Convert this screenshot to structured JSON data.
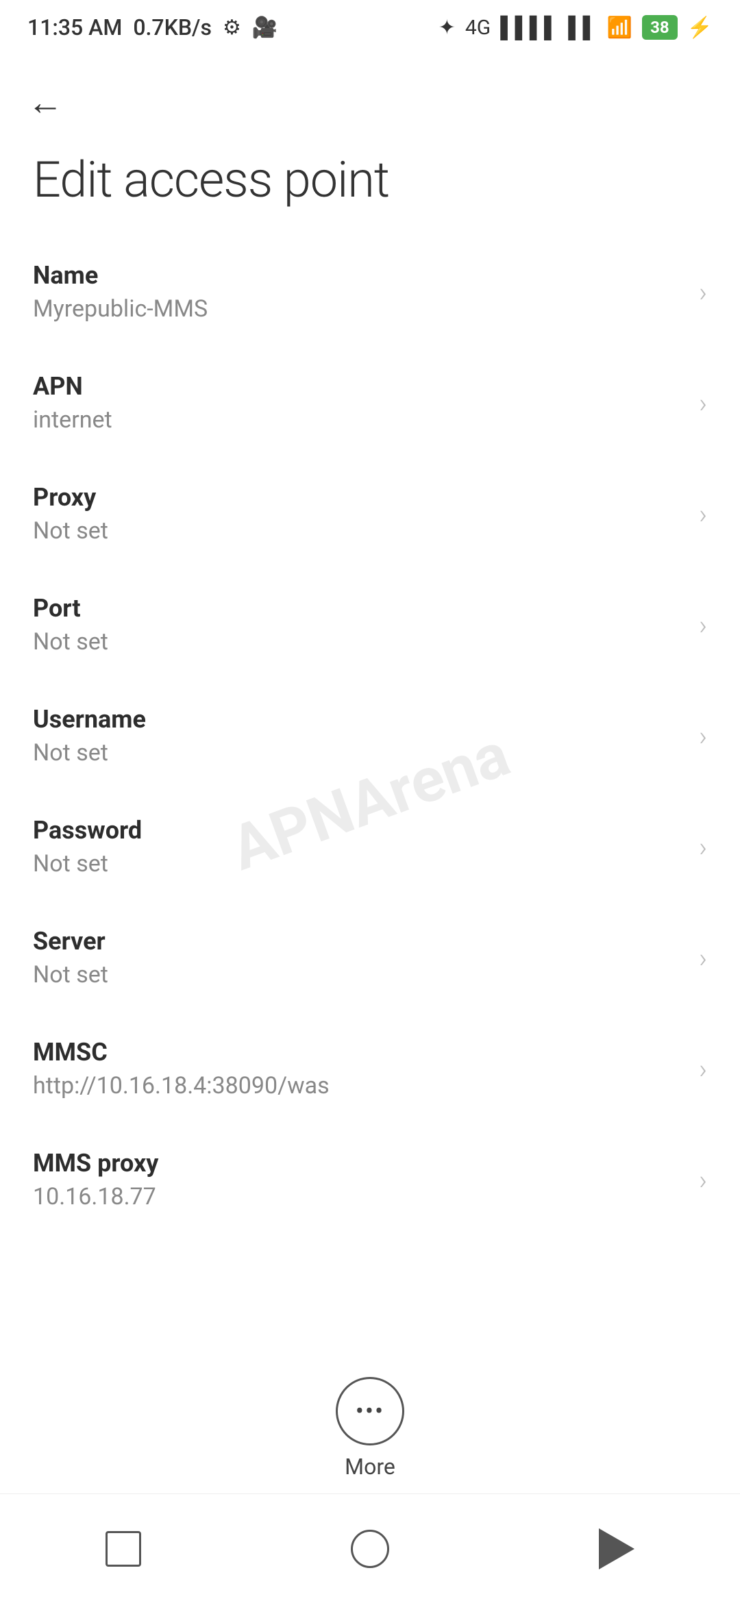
{
  "status_bar": {
    "time": "11:35 AM",
    "data_speed": "0.7KB/s",
    "battery_level": "38"
  },
  "header": {
    "back_label": "←",
    "title": "Edit access point"
  },
  "settings_items": [
    {
      "label": "Name",
      "value": "Myrepublic-MMS"
    },
    {
      "label": "APN",
      "value": "internet"
    },
    {
      "label": "Proxy",
      "value": "Not set"
    },
    {
      "label": "Port",
      "value": "Not set"
    },
    {
      "label": "Username",
      "value": "Not set"
    },
    {
      "label": "Password",
      "value": "Not set"
    },
    {
      "label": "Server",
      "value": "Not set"
    },
    {
      "label": "MMSC",
      "value": "http://10.16.18.4:38090/was"
    },
    {
      "label": "MMS proxy",
      "value": "10.16.18.77"
    }
  ],
  "more_button": {
    "label": "More"
  },
  "nav_bar": {
    "square_label": "recent-apps",
    "circle_label": "home",
    "triangle_label": "back"
  }
}
